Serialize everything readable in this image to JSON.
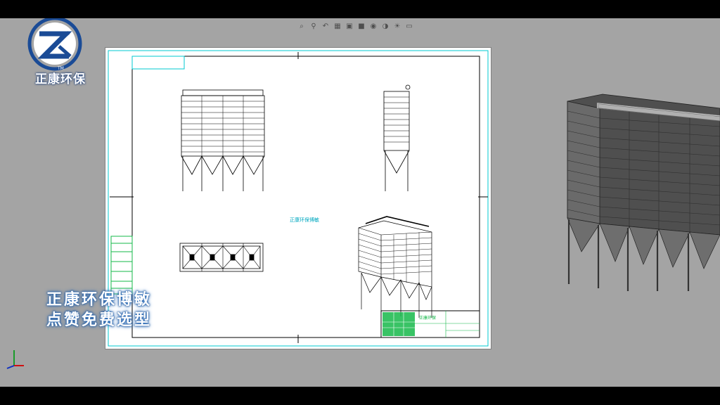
{
  "toolbar": {
    "buttons": [
      "zoom-fit-icon",
      "zoom-area-icon",
      "prev-view-icon",
      "section-icon",
      "view-orientation-icon",
      "display-style-icon",
      "hide-show-icon",
      "edit-appearance-icon",
      "scene-icon",
      "view-settings-icon"
    ]
  },
  "logo": {
    "brand": "正康环保",
    "tm": "TM"
  },
  "drawing": {
    "center_label": "正康环保博敏",
    "title_block_name": "正康环保"
  },
  "caption": {
    "line1": "正康环保博敏",
    "line2": "点赞免费选型"
  },
  "colors": {
    "viewport_bg": "#a4a4a4",
    "sheet_border": "#00c8d0",
    "title_block_green": "#16b84a",
    "logo_blue": "#1a4b96"
  }
}
